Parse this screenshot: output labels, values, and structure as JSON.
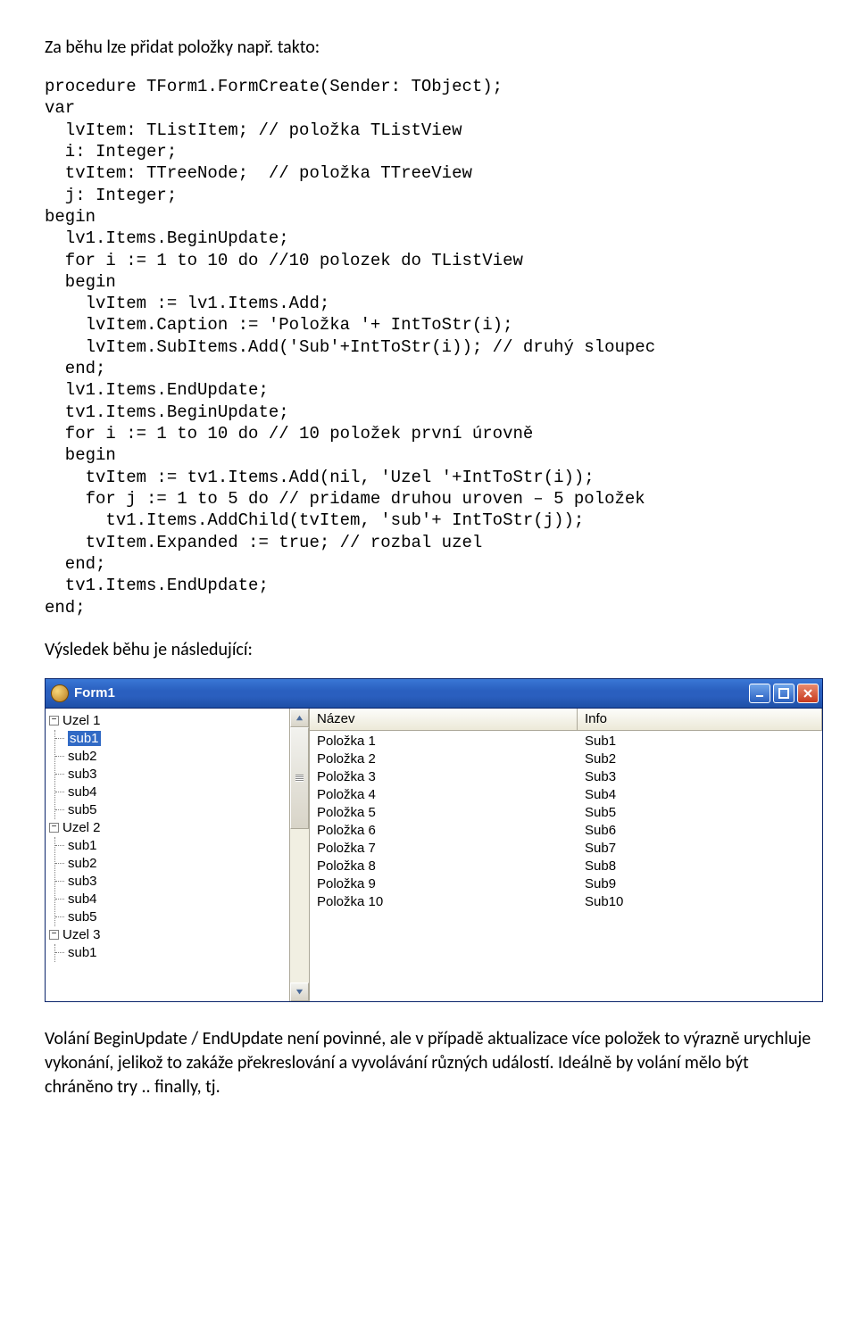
{
  "intro_text": "Za běhu lze přidat položky např. takto:",
  "code_lines": [
    "procedure TForm1.FormCreate(Sender: TObject);",
    "var",
    "  lvItem: TListItem; // položka TListView",
    "  i: Integer;",
    "  tvItem: TTreeNode;  // položka TTreeView",
    "  j: Integer;",
    "begin",
    "  lv1.Items.BeginUpdate;",
    "  for i := 1 to 10 do //10 polozek do TListView",
    "  begin",
    "    lvItem := lv1.Items.Add;",
    "    lvItem.Caption := 'Položka '+ IntToStr(i);",
    "    lvItem.SubItems.Add('Sub'+IntToStr(i)); // druhý sloupec",
    "  end;",
    "  lv1.Items.EndUpdate;",
    "",
    "  tv1.Items.BeginUpdate;",
    "  for i := 1 to 10 do // 10 položek první úrovně",
    "  begin",
    "    tvItem := tv1.Items.Add(nil, 'Uzel '+IntToStr(i));",
    "    for j := 1 to 5 do // pridame druhou uroven – 5 položek",
    "      tv1.Items.AddChild(tvItem, 'sub'+ IntToStr(j));",
    "    tvItem.Expanded := true; // rozbal uzel",
    "  end;",
    "  tv1.Items.EndUpdate;",
    "end;"
  ],
  "result_label": "Výsledek běhu je následující:",
  "window": {
    "title": "Form1",
    "tree": {
      "nodes": [
        {
          "label": "Uzel 1",
          "children": [
            "sub1",
            "sub2",
            "sub3",
            "sub4",
            "sub5"
          ],
          "selected_child_index": 0
        },
        {
          "label": "Uzel 2",
          "children": [
            "sub1",
            "sub2",
            "sub3",
            "sub4",
            "sub5"
          ]
        },
        {
          "label": "Uzel 3",
          "children": [
            "sub1"
          ]
        }
      ],
      "expander_symbol": "−"
    },
    "listview": {
      "columns": [
        "Název",
        "Info"
      ],
      "rows": [
        [
          "Položka 1",
          "Sub1"
        ],
        [
          "Položka 2",
          "Sub2"
        ],
        [
          "Položka 3",
          "Sub3"
        ],
        [
          "Položka 4",
          "Sub4"
        ],
        [
          "Položka 5",
          "Sub5"
        ],
        [
          "Položka 6",
          "Sub6"
        ],
        [
          "Položka 7",
          "Sub7"
        ],
        [
          "Položka 8",
          "Sub8"
        ],
        [
          "Položka 9",
          "Sub9"
        ],
        [
          "Položka 10",
          "Sub10"
        ]
      ]
    }
  },
  "footer_paragraphs": [
    "Volání BeginUpdate / EndUpdate není povinné, ale v případě aktualizace více položek to výrazně urychluje vykonání, jelikož to zakáže překreslování a vyvolávání různých událostí. Ideálně by volání mělo být chráněno try .. finally, tj."
  ]
}
